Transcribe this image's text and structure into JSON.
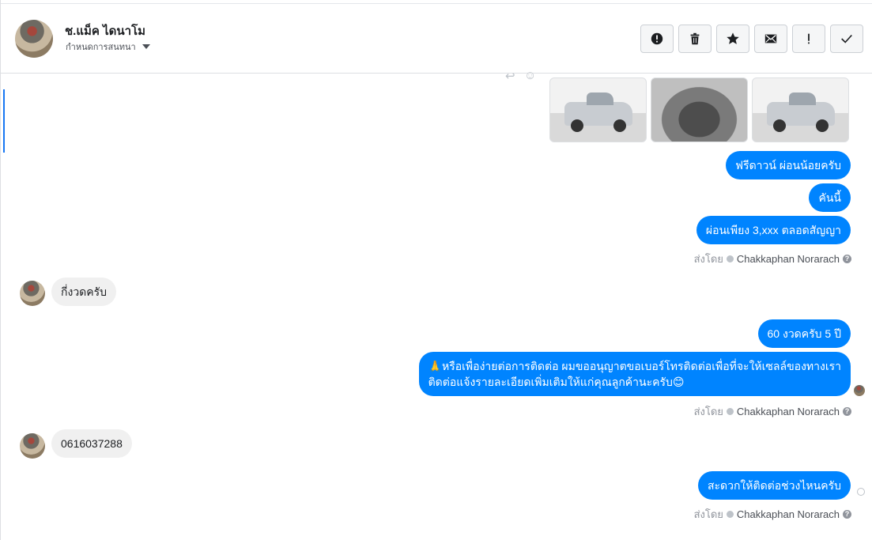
{
  "header": {
    "title": "ช.แม็ค ไดนาโม",
    "subtitle": "กำหนดการสนทนา",
    "toolbar": [
      "alert-circle-icon",
      "trash-icon",
      "star-icon",
      "mail-icon",
      "exclamation-icon",
      "check-icon"
    ]
  },
  "messages": {
    "m1": "ฟรีดาวน์ ผ่อนน้อยครับ",
    "m2": "คันนี้",
    "m3": "ผ่อนเพียง 3,xxx ตลอดสัญญา",
    "in1": "กี่งวดครับ",
    "m4": "60 งวดครับ 5 ปี",
    "m5_line1": "🙏หรือเพื่อง่ายต่อการติดต่อ ผมขออนุญาตขอเบอร์โทรติดต่อเพื่อที่จะให้เซลล์ของทางเรา",
    "m5_line2": "ติดต่อแจ้งรายละเอียดเพิ่มเติมให้แก่คุณลูกค้านะครับ😊",
    "in2": "0616037288",
    "m6": "สะดวกให้ติดต่อช่วงไหนครับ"
  },
  "sent_by": {
    "prefix": "ส่งโดย",
    "name": "Chakkaphan Norarach",
    "help": "?"
  },
  "colors": {
    "outgoing": "#0084ff",
    "incoming": "#f0f0f0",
    "accent": "#1877f2"
  }
}
